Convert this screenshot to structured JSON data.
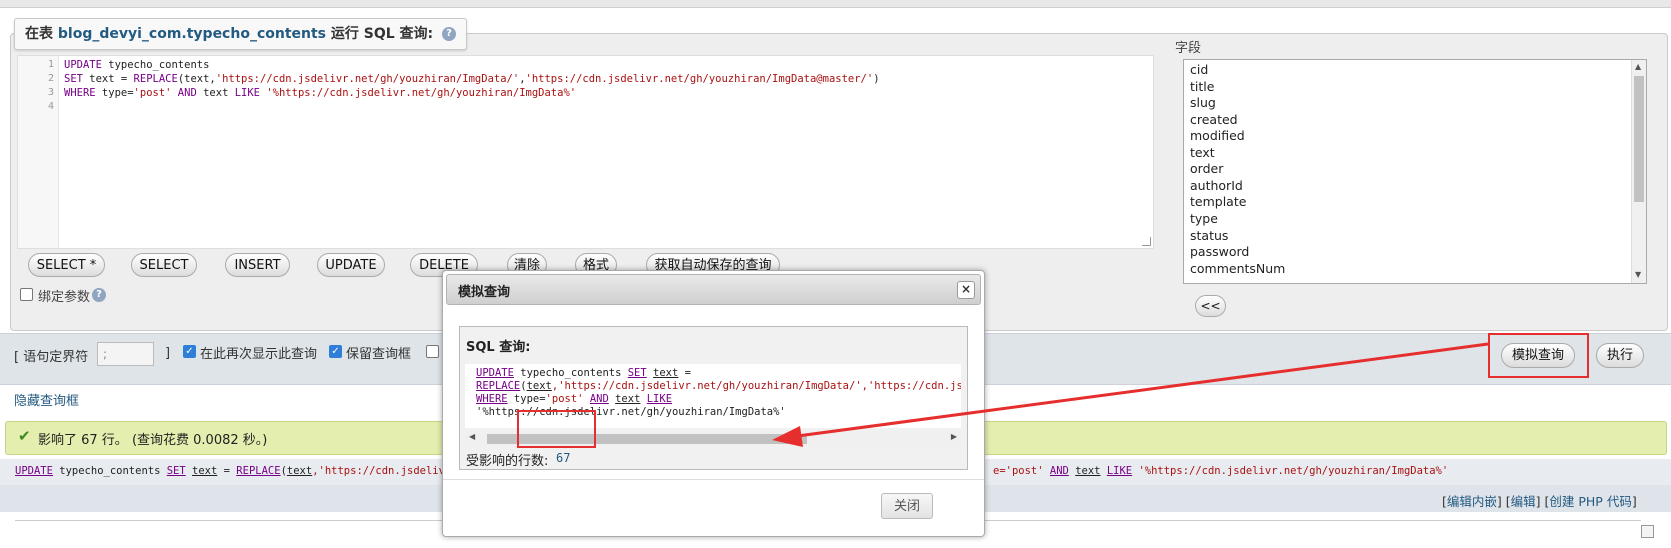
{
  "query_box": {
    "legend_prefix": "在表",
    "table_name": "blog_devyi_com.typecho_contents",
    "legend_suffix": "运行 SQL 查询:",
    "help_glyph": "?",
    "line_numbers": [
      "1",
      "2",
      "3",
      "4"
    ],
    "code": {
      "l1_kw": "UPDATE",
      "l1_rest": " typecho_contents",
      "l2_kw": "SET",
      "l2_a": " text = ",
      "l2_fn": "REPLACE",
      "l2_b": "(text,",
      "l2_s1": "'https://cdn.jsdelivr.net/gh/youzhiran/ImgData/'",
      "l2_c": ",",
      "l2_s2": "'https://cdn.jsdelivr.net/gh/youzhiran/ImgData@master/'",
      "l2_d": ")",
      "l3_kw1": "WHERE",
      "l3_a": " type=",
      "l3_s1": "'post'",
      "l3_kw2": " AND",
      "l3_b": " text ",
      "l3_kw3": "LIKE",
      "l3_s2": " '%https://cdn.jsdelivr.net/gh/youzhiran/ImgData%'"
    },
    "buttons": [
      "SELECT *",
      "SELECT",
      "INSERT",
      "UPDATE",
      "DELETE",
      "清除",
      "格式",
      "获取自动保存的查询"
    ],
    "bind_params_label": "绑定参数",
    "fields_label": "字段",
    "fields": [
      "cid",
      "title",
      "slug",
      "created",
      "modified",
      "text",
      "order",
      "authorId",
      "template",
      "type",
      "status",
      "password",
      "commentsNum"
    ],
    "insert_button": "<<"
  },
  "toolbar": {
    "delimiter_label": "[ 语句定界符",
    "delimiter_value": ";",
    "delimiter_close": "]",
    "show_again_label": "在此再次显示此查询",
    "keep_box_label": "保留查询框",
    "simulate_button": "模拟查询",
    "execute_button": "执行"
  },
  "hide_query_box": "隐藏查询框",
  "result": {
    "success_text": "影响了 67 行。 (查询花费 0.0082 秒。)",
    "sql_left": {
      "update": "UPDATE",
      "t1": " typecho_contents ",
      "set": "SET",
      "sp1": " ",
      "text1": "text",
      "eq": " = ",
      "replace": "REPLACE",
      "open": "(",
      "text2": "text",
      "tail": ",'https://cdn.jsdelivr.ne"
    },
    "sql_right": {
      "head": "e='post' ",
      "and": "AND",
      "sp": " ",
      "text": "text",
      "sp2": " ",
      "like": "LIKE",
      "tail": " '%https://cdn.jsdelivr.net/gh/youzhiran/ImgData%'"
    },
    "links": {
      "open": "[",
      "edit_inline": "编辑内嵌",
      "sep1": "] [",
      "edit": "编辑",
      "sep2": "] [",
      "create_php": "创建 PHP 代码",
      "close": "]"
    }
  },
  "dialog": {
    "title": "模拟查询",
    "close_glyph": "×",
    "sql_label": "SQL 查询:",
    "code": {
      "l1_kw": "UPDATE",
      "l1_a": " typecho_contents ",
      "l1_set": "SET",
      "l1_sp": " ",
      "l1_text": "text",
      "l1_b": " =",
      "l2_fn": "REPLACE",
      "l2_open": "(",
      "l2_text": "text",
      "l2_rest": ",'https://cdn.jsdelivr.net/gh/youzhiran/ImgData/','https://cdn.jsdeli",
      "l3_kw": "WHERE",
      "l3_a": " type=",
      "l3_s": "'post'",
      "l3_sp": " ",
      "l3_and": "AND",
      "l3_sp2": " ",
      "l3_text": "text",
      "l3_sp3": " ",
      "l3_like": "LIKE",
      "l4": "'%https://cdn.jsdelivr.net/gh/youzhiran/ImgData%'"
    },
    "affected_label": "受影响的行数:",
    "affected_value": "67",
    "close_button": "关闭"
  },
  "colors": {
    "annotation": "#e62e2e",
    "link": "#235a81",
    "success_bg": "#e4eeae"
  }
}
